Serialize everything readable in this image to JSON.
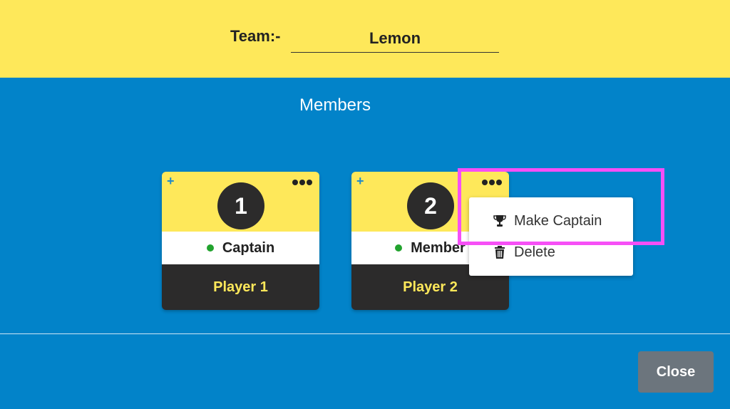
{
  "header": {
    "team_label": "Team:-",
    "team_name": "Lemon"
  },
  "members_title": "Members",
  "cards": [
    {
      "number": "1",
      "role": "Captain",
      "name": "Player 1"
    },
    {
      "number": "2",
      "role": "Member",
      "name": "Player 2"
    }
  ],
  "context_menu": {
    "make_captain": "Make Captain",
    "delete": "Delete"
  },
  "footer": {
    "close_label": "Close"
  },
  "colors": {
    "yellow": "#fee85a",
    "blue": "#0283c9",
    "dark": "#2c2b2b",
    "highlight": "#f64ff6",
    "online_dot": "#22a32e"
  }
}
